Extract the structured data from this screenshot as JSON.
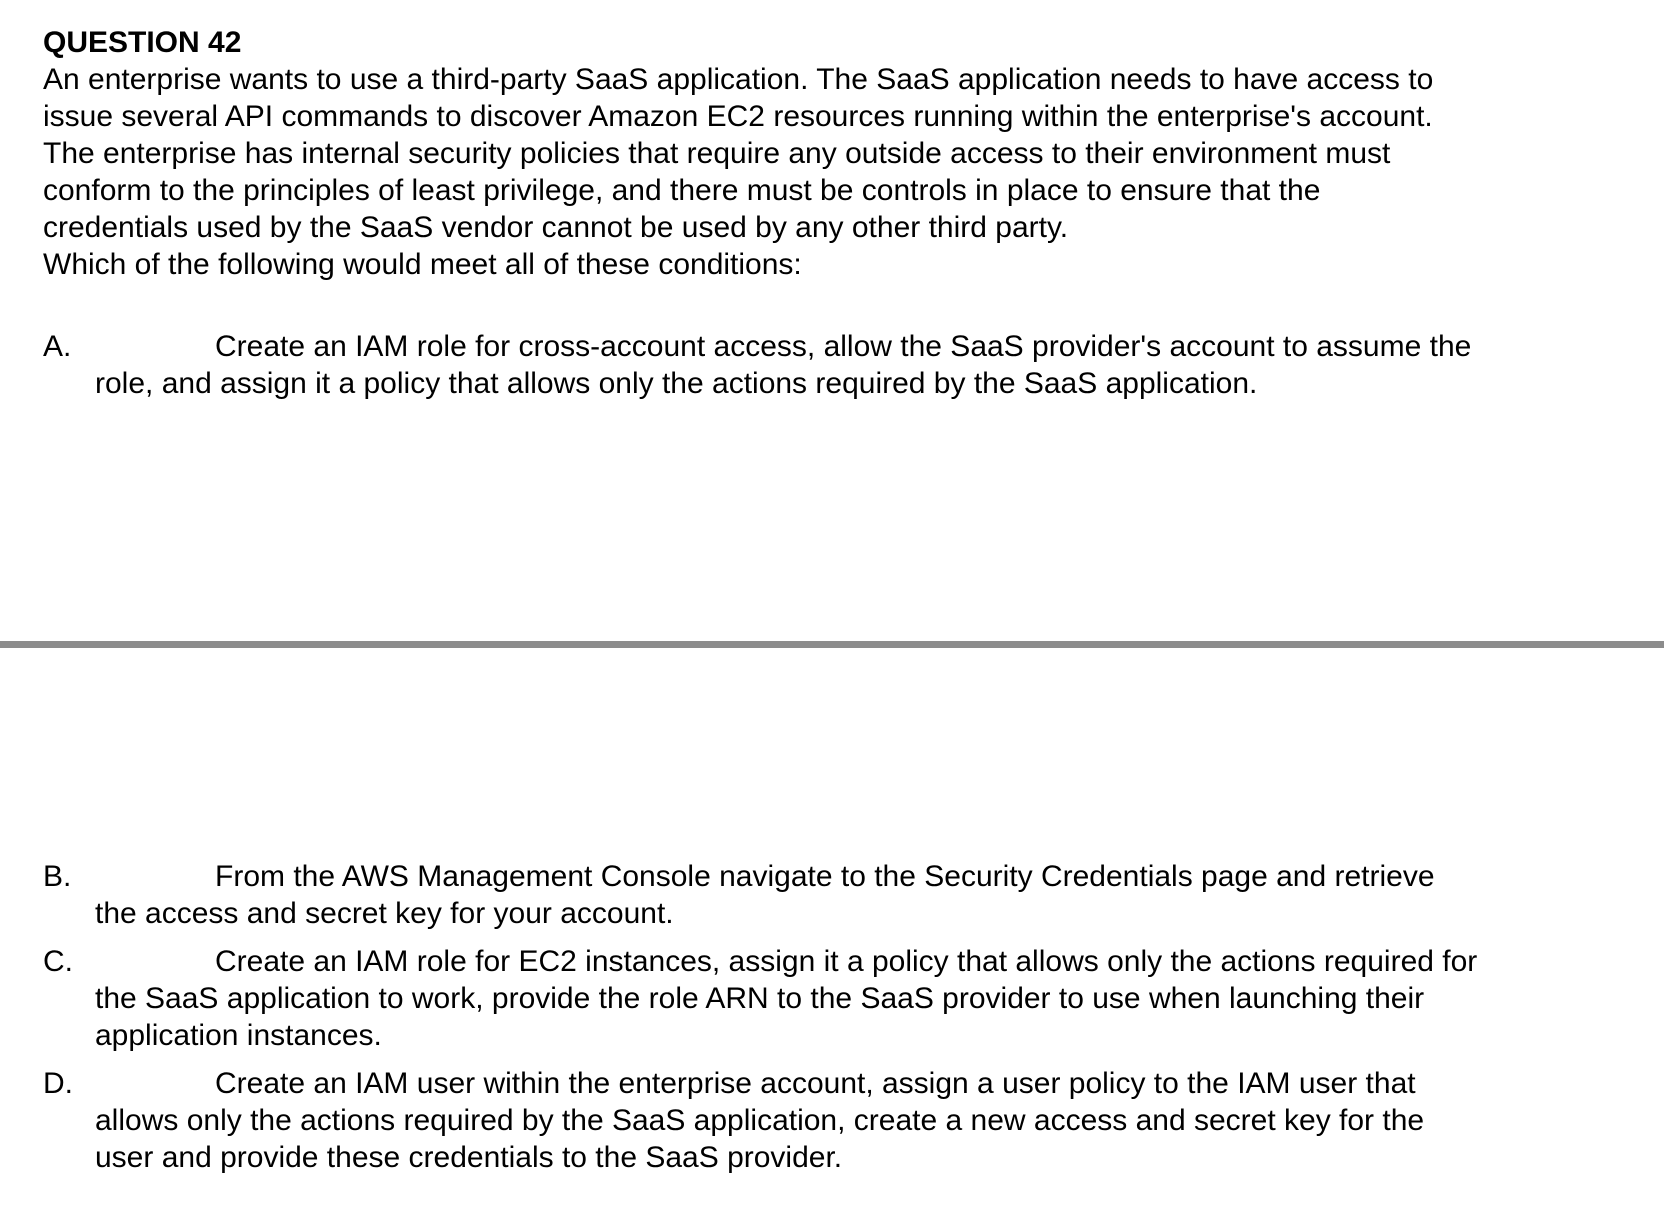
{
  "question": {
    "title": "QUESTION 42",
    "stem_lines": [
      "An enterprise wants to use a third-party SaaS application. The SaaS application needs to have access to",
      "issue several API commands to discover Amazon EC2 resources running within the enterprise's account.",
      "The enterprise has internal security policies that require any outside access to their environment must",
      "conform to the principles of least privilege, and there must be controls in place to ensure that the",
      "credentials used by the SaaS vendor cannot be used by any other third party.",
      "Which of the following would meet all of these conditions:"
    ]
  },
  "options": [
    {
      "letter": "A.",
      "lines": [
        "Create an IAM role for cross-account access, allow the SaaS provider's account to assume the",
        "role, and assign it a policy that allows only the actions required by the SaaS application."
      ]
    },
    {
      "letter": "B.",
      "lines": [
        "From the AWS Management Console navigate to the Security Credentials page and retrieve",
        "the access and secret key for your account."
      ]
    },
    {
      "letter": "C.",
      "lines": [
        "Create an IAM role for EC2 instances, assign it a policy that allows only the actions required for",
        "the SaaS application to work, provide the role ARN to the SaaS provider to use when launching their",
        "application instances."
      ]
    },
    {
      "letter": "D.",
      "lines": [
        "Create an IAM user within the enterprise account, assign a user policy to the IAM user that",
        "allows only the actions required by the SaaS application, create a new access and secret key for the",
        "user and provide these credentials to the SaaS provider."
      ]
    }
  ]
}
